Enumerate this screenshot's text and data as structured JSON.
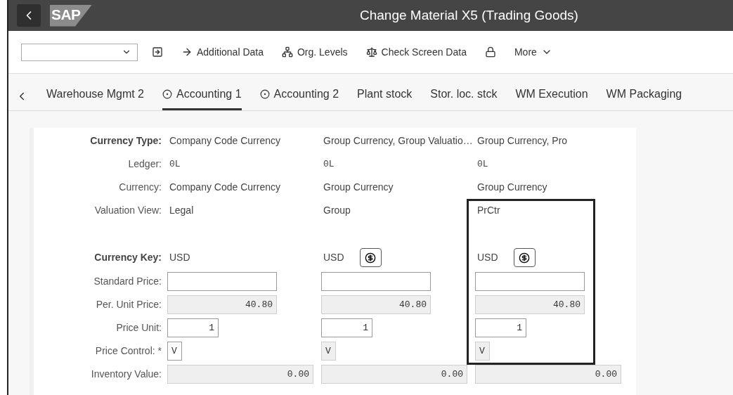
{
  "header": {
    "logo": "SAP",
    "title": "Change Material X5 (Trading Goods)"
  },
  "toolbar": {
    "items": [
      {
        "kind": "icon"
      },
      {
        "kind": "button",
        "label": "Additional Data"
      },
      {
        "kind": "button",
        "label": "Org. Levels"
      },
      {
        "kind": "button",
        "label": "Check Screen Data"
      },
      {
        "kind": "icon"
      },
      {
        "kind": "menu",
        "label": "More"
      }
    ]
  },
  "tabs": [
    {
      "label": "Warehouse Mgmt 2",
      "selected": false,
      "has_icon": false
    },
    {
      "label": "Accounting 1",
      "selected": true,
      "has_icon": true
    },
    {
      "label": "Accounting 2",
      "selected": false,
      "has_icon": true
    },
    {
      "label": "Plant stock",
      "selected": false,
      "has_icon": false
    },
    {
      "label": "Stor. loc. stck",
      "selected": false,
      "has_icon": false
    },
    {
      "label": "WM Execution",
      "selected": false,
      "has_icon": false
    },
    {
      "label": "WM Packaging",
      "selected": false,
      "has_icon": false
    }
  ],
  "info_rows": [
    {
      "label": "Currency Type:",
      "emphasized": true,
      "mono": false,
      "values": [
        "Company Code Currency",
        "Group Currency, Group Valuatio…",
        "Group Currency, Pro"
      ]
    },
    {
      "label": "Ledger:",
      "emphasized": false,
      "mono": true,
      "values": [
        "0L",
        "0L",
        "0L"
      ]
    },
    {
      "label": "Currency:",
      "emphasized": false,
      "mono": false,
      "values": [
        "Company Code Currency",
        "Group Currency",
        "Group Currency"
      ]
    },
    {
      "label": "Valuation View:",
      "emphasized": false,
      "mono": false,
      "values": [
        "Legal",
        "Group",
        "PrCtr"
      ]
    }
  ],
  "currency_key": {
    "label": "Currency Key:",
    "values": [
      {
        "value": "USD",
        "converter": false,
        "highlighted": false
      },
      {
        "value": "USD",
        "converter": true,
        "highlighted": false
      },
      {
        "value": "USD",
        "converter": true,
        "highlighted": true
      }
    ]
  },
  "field_rows": [
    {
      "label": "Standard Price:",
      "kind": "amount",
      "values": [
        {
          "editable": true
        },
        {
          "editable": true
        },
        {
          "editable": true
        }
      ]
    },
    {
      "label": "Per. Unit Price:",
      "kind": "amount",
      "values": [
        {
          "value": "40.80",
          "editable": false
        },
        {
          "value": "40.80",
          "editable": false
        },
        {
          "value": "40.80",
          "editable": false
        }
      ]
    },
    {
      "label": "Price Unit:",
      "kind": "unit",
      "values": [
        {
          "value": "1",
          "editable": true
        },
        {
          "value": "1",
          "editable": true
        },
        {
          "value": "1",
          "editable": true
        }
      ]
    },
    {
      "label": "Price Control: *",
      "kind": "indicator",
      "values": [
        {
          "value": "V",
          "editable": true
        },
        {
          "value": "V",
          "editable": false
        },
        {
          "value": "V",
          "editable": false
        }
      ]
    },
    {
      "label": "Inventory Value:",
      "kind": "total",
      "values": [
        {
          "value": "0.00",
          "editable": false
        },
        {
          "value": "0.00",
          "editable": false
        },
        {
          "value": "0.00",
          "editable": false
        }
      ]
    }
  ]
}
